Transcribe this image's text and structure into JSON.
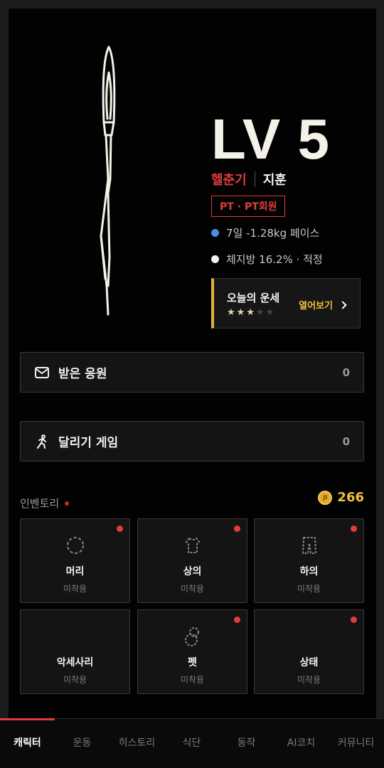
{
  "character": {
    "level": "LV 5",
    "rank": "헬춘기",
    "username": "지훈",
    "badge": "PT · PT회원",
    "stats": [
      {
        "text": "7일 -1.28kg 페이스",
        "color": "#4a8fe7"
      },
      {
        "text": "체지방 16.2% · 적정",
        "color": "#f2f2f2"
      }
    ],
    "fortune": {
      "title": "오늘의 운세",
      "stars": 3,
      "max_stars": 5,
      "open_label": "열어보기"
    }
  },
  "cards": [
    {
      "icon": "mail-icon",
      "label": "받은 응원",
      "count": "0"
    },
    {
      "icon": "runner-icon",
      "label": "달리기 게임",
      "count": "0"
    }
  ],
  "inventory": {
    "title": "인벤토리",
    "coin_label": "JI",
    "coins": "266",
    "slots": [
      {
        "icon": "hair-icon",
        "name": "머리",
        "state": "미착용",
        "new": true
      },
      {
        "icon": "top-icon",
        "name": "상의",
        "state": "미착용",
        "new": true
      },
      {
        "icon": "bottom-icon",
        "name": "하의",
        "state": "미착용",
        "new": true
      },
      {
        "icon": "",
        "name": "악세사리",
        "state": "미착용",
        "new": false
      },
      {
        "icon": "pet-icon",
        "name": "펫",
        "state": "미착용",
        "new": true
      },
      {
        "icon": "",
        "name": "상태",
        "state": "미착용",
        "new": true
      }
    ]
  },
  "tabs": [
    {
      "label": "캐릭터",
      "active": true
    },
    {
      "label": "운동",
      "active": false
    },
    {
      "label": "히스토리",
      "active": false
    },
    {
      "label": "식단",
      "active": false
    },
    {
      "label": "동작",
      "active": false
    },
    {
      "label": "AI코치",
      "active": false
    },
    {
      "label": "커뮤니티",
      "active": false
    }
  ]
}
